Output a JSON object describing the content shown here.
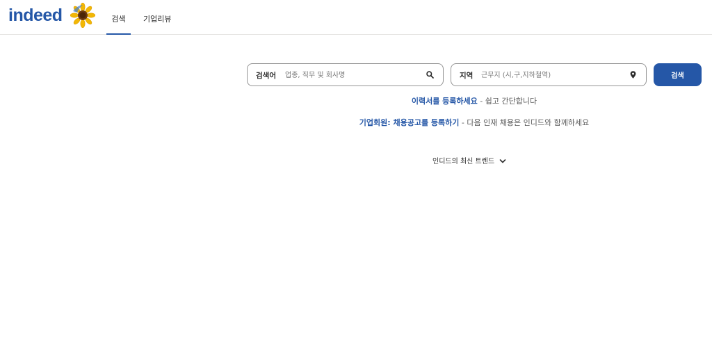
{
  "header": {
    "logo_text": "indeed",
    "logo_icon": "sunflower-icon",
    "tabs": [
      {
        "label": "검색",
        "active": true
      },
      {
        "label": "기업리뷰",
        "active": false
      }
    ]
  },
  "search": {
    "what_label": "검색어",
    "what_placeholder": "업종, 직무 및 회사명",
    "what_icon": "search-icon",
    "where_label": "지역",
    "where_placeholder": "근무지 (시,구,지하철역)",
    "where_icon": "location-pin-icon",
    "button_label": "검색"
  },
  "promos": {
    "resume_link": "이력서를 등록하세요",
    "resume_text": " - 쉽고 간단합니다",
    "employer_link": "기업회원: 채용공고를 등록하기",
    "employer_text": " - 다음 인재 채용은 인디드와 함께하세요"
  },
  "trends": {
    "label": "인디드의 최신 트렌드",
    "icon": "chevron-down-icon"
  },
  "colors": {
    "brand": "#2557a7",
    "border": "#949494",
    "divider": "#e4e2e0"
  }
}
